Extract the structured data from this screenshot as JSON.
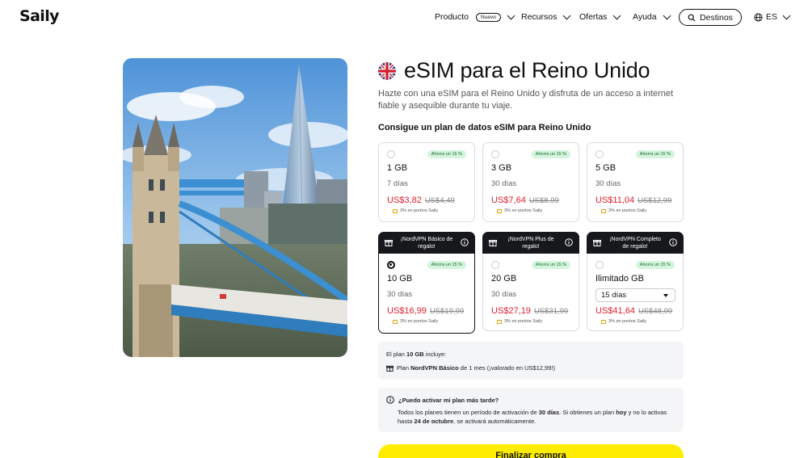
{
  "header": {
    "logo": "Saily",
    "nav": [
      {
        "label": "Producto",
        "badge": "Nuevo"
      },
      {
        "label": "Recursos"
      },
      {
        "label": "Ofertas"
      },
      {
        "label": "Ayuda"
      }
    ],
    "destinations_button": "Destinos",
    "language": "ES"
  },
  "page": {
    "title": "eSIM para el Reino Unido",
    "subtitle": "Hazte con una eSIM para el Reino Unido y disfruta de un acceso a internet fiable y asequible durante tu viaje.",
    "plans_heading": "Consigue un plan de datos eSIM para Reino Unido"
  },
  "plans": [
    {
      "data": "1 GB",
      "days": "7 días",
      "price": "US$3,82",
      "old_price": "US$4,49",
      "save": "Ahorra un 15 %",
      "points": "3% en puntos Saily"
    },
    {
      "data": "3 GB",
      "days": "30 días",
      "price": "US$7,64",
      "old_price": "US$8,99",
      "save": "Ahorra un 15 %",
      "points": "3% en puntos Saily"
    },
    {
      "data": "5 GB",
      "days": "30 días",
      "price": "US$11,04",
      "old_price": "US$12,99",
      "save": "Ahorra un 15 %",
      "points": "3% en puntos Saily"
    },
    {
      "data": "10 GB",
      "days": "30 días",
      "price": "US$16,99",
      "old_price": "US$19,99",
      "save": "Ahorra un 15 %",
      "points": "3% en puntos Saily",
      "promo": "¡NordVPN Básico de regalo!",
      "selected": true
    },
    {
      "data": "20 GB",
      "days": "30 días",
      "price": "US$27,19",
      "old_price": "US$31,99",
      "save": "Ahorra un 15 %",
      "points": "3% en puntos Saily",
      "promo": "¡NordVPN Plus de regalo!"
    },
    {
      "data": "Ilimitado GB",
      "days_select": "15 días",
      "price": "US$41,64",
      "old_price": "US$48,99",
      "save": "Ahorra un 15 %",
      "points": "3% en puntos Saily",
      "promo": "¡NordVPN Completo de regalo!"
    }
  ],
  "includes": {
    "label_prefix": "El plan ",
    "label_plan": "10 GB",
    "label_suffix": " incluye:",
    "item_prefix": "Plan ",
    "item_bold": "NordVPN Básico",
    "item_suffix": " de 1 mes (¡valorado en US$12,99!)"
  },
  "faq": {
    "question": "¿Puedo activar mi plan más tarde?",
    "a1": "Todos los planes tienen un período de activación de ",
    "a_days": "30 días",
    "a2": ". Si obtienes un plan ",
    "a_today": "hoy",
    "a3": " y no lo activas hasta ",
    "a_date": "24 de octubre",
    "a4": ", se activará automáticamente."
  },
  "cta": "Finalizar compra",
  "colors": {
    "accent": "#ffed00",
    "price": "#e0212f",
    "save_bg": "#d3f5dc",
    "promo_bg": "#17181c"
  }
}
